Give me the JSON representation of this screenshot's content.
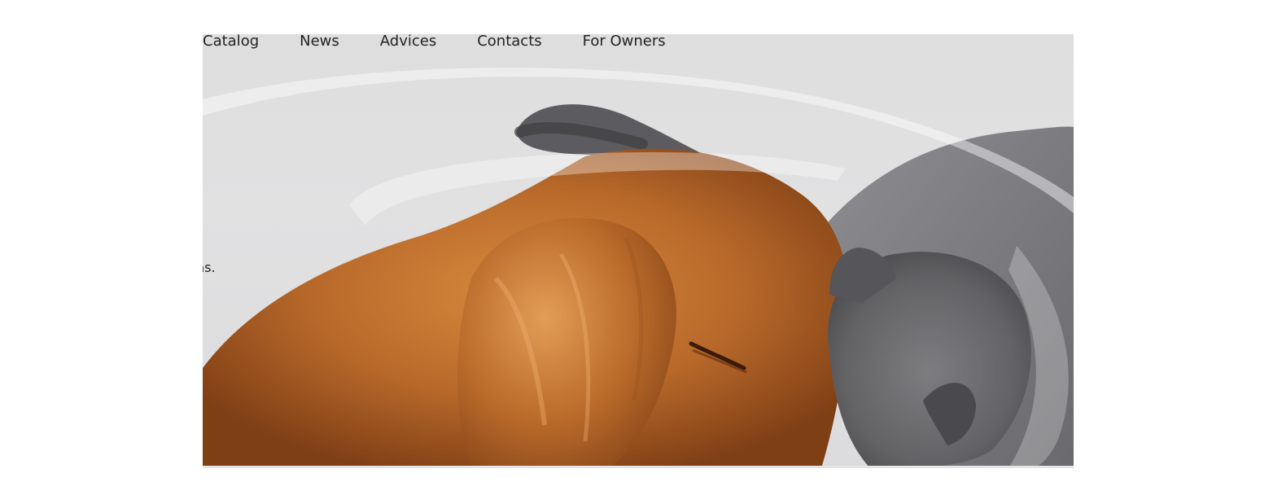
{
  "nav": {
    "items": [
      {
        "label": "Catalog"
      },
      {
        "label": "News"
      },
      {
        "label": "Advices"
      },
      {
        "label": "Contacts"
      },
      {
        "label": "For Owners"
      }
    ]
  },
  "hero": {
    "text_fragment": "ns.",
    "image_subject": "golden dog and grey cat nuzzling"
  },
  "colors": {
    "background": "#dfdfe0",
    "dog": "#b8692a",
    "cat": "#6f6f72",
    "text": "#222222"
  }
}
